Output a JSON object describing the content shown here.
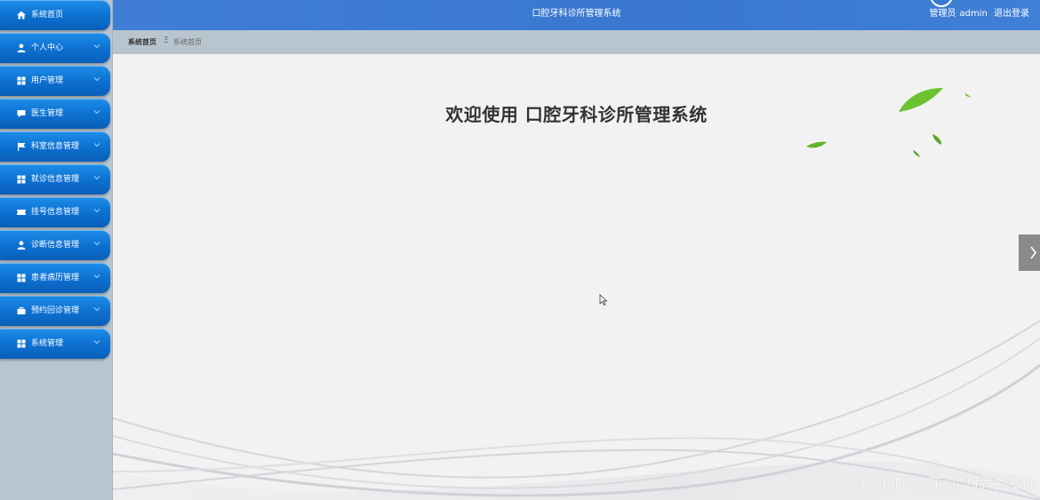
{
  "header": {
    "title": "口腔牙科诊所管理系统",
    "user_role": "管理员",
    "username": "admin",
    "logout": "退出登录"
  },
  "breadcrumb": {
    "home": "系统首页",
    "separator": "Ξ",
    "current": "系统首页"
  },
  "main": {
    "welcome": "欢迎使用 口腔牙科诊所管理系统"
  },
  "sidebar": {
    "items": [
      {
        "label": "系统首页",
        "icon": "home-icon"
      },
      {
        "label": "个人中心",
        "icon": "user-icon"
      },
      {
        "label": "用户管理",
        "icon": "grid-icon"
      },
      {
        "label": "医生管理",
        "icon": "chat-icon"
      },
      {
        "label": "科室信息管理",
        "icon": "flag-icon"
      },
      {
        "label": "就诊信息管理",
        "icon": "grid-icon"
      },
      {
        "label": "挂号信息管理",
        "icon": "ticket-icon"
      },
      {
        "label": "诊断信息管理",
        "icon": "user-icon"
      },
      {
        "label": "患者病历管理",
        "icon": "grid-icon"
      },
      {
        "label": "预约回诊管理",
        "icon": "briefcase-icon"
      },
      {
        "label": "系统管理",
        "icon": "grid-icon"
      }
    ]
  },
  "watermark": "CSDN @花儿  *程序设计",
  "colors": {
    "header_blue": "#3f7ed4",
    "menu_blue": "#0c6fd0",
    "sidebar_bg": "#b8c5d0",
    "leaf_green": "#6cc230"
  }
}
